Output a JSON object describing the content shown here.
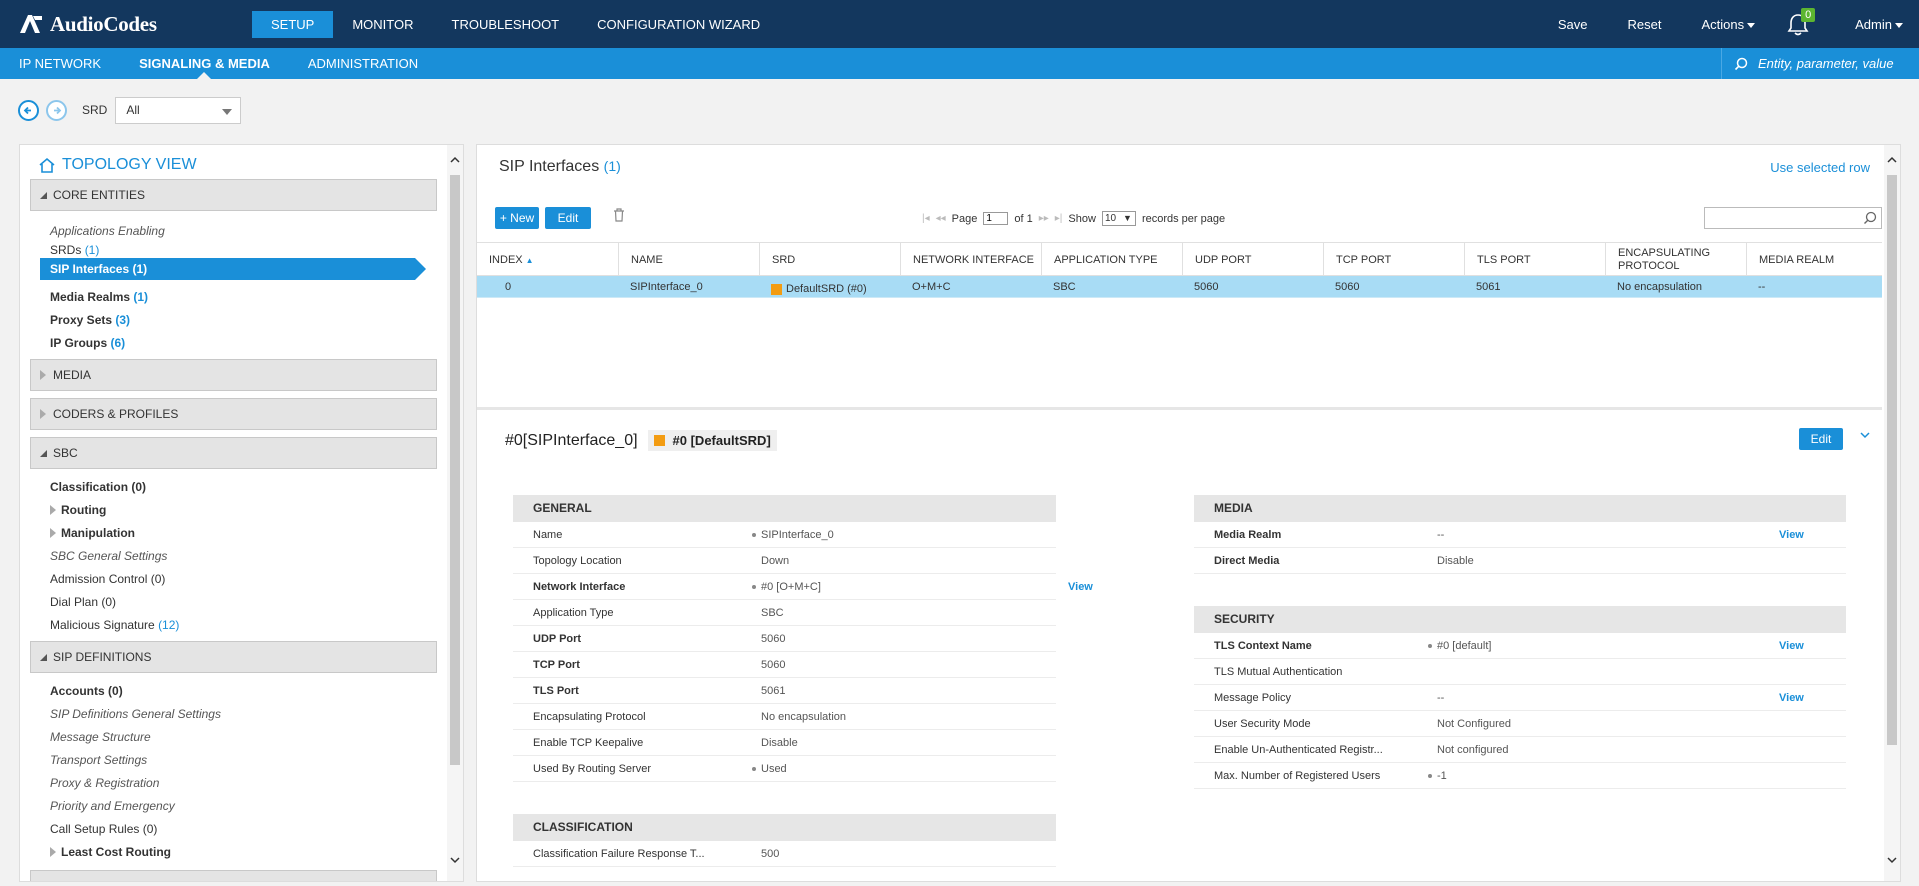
{
  "brand": {
    "name": "AudioCodes"
  },
  "main_nav": [
    {
      "label": "SETUP",
      "active": true
    },
    {
      "label": "MONITOR"
    },
    {
      "label": "TROUBLESHOOT"
    },
    {
      "label": "CONFIGURATION WIZARD"
    }
  ],
  "top_actions": {
    "save": "Save",
    "reset": "Reset",
    "actions": "Actions",
    "notifications": "0",
    "user": "Admin"
  },
  "sub_nav": [
    {
      "label": "IP NETWORK"
    },
    {
      "label": "SIGNALING & MEDIA",
      "active": true
    },
    {
      "label": "ADMINISTRATION"
    }
  ],
  "global_search": {
    "placeholder": "Entity, parameter, value"
  },
  "srd": {
    "label": "SRD",
    "value": "All"
  },
  "topology": {
    "title": "TOPOLOGY VIEW",
    "core_entities": {
      "label": "CORE ENTITIES",
      "items": [
        {
          "label": "Applications Enabling",
          "count": ""
        },
        {
          "label": "SRDs",
          "count": "(1)"
        },
        {
          "label": "SIP Interfaces",
          "count": "(1)"
        },
        {
          "label": "Media Realms",
          "count": "(1)"
        },
        {
          "label": "Proxy Sets",
          "count": "(3)"
        },
        {
          "label": "IP Groups",
          "count": "(6)"
        }
      ]
    },
    "media": {
      "label": "MEDIA"
    },
    "coders": {
      "label": "CODERS & PROFILES"
    },
    "sbc": {
      "label": "SBC",
      "items": [
        {
          "label": "Classification",
          "count": "(0)"
        },
        {
          "label": "Routing"
        },
        {
          "label": "Manipulation"
        },
        {
          "label": "SBC General Settings"
        },
        {
          "label": "Admission Control",
          "count": "(0)"
        },
        {
          "label": "Dial Plan",
          "count": "(0)"
        },
        {
          "label": "Malicious Signature",
          "count": "(12)"
        }
      ]
    },
    "sip_definitions": {
      "label": "SIP DEFINITIONS",
      "items": [
        {
          "label": "Accounts",
          "count": "(0)"
        },
        {
          "label": "SIP Definitions General Settings"
        },
        {
          "label": "Message Structure"
        },
        {
          "label": "Transport Settings"
        },
        {
          "label": "Proxy & Registration"
        },
        {
          "label": "Priority and Emergency"
        },
        {
          "label": "Call Setup Rules",
          "count": "(0)"
        },
        {
          "label": "Least Cost Routing"
        }
      ]
    }
  },
  "table": {
    "title": "SIP Interfaces",
    "count": "(1)",
    "use_selected": "Use selected row",
    "new_btn": "+ New",
    "edit_btn": "Edit",
    "pager": {
      "page_label": "Page",
      "page_value": "1",
      "of_label": "of 1",
      "show_label": "Show",
      "per_page": "10",
      "records_label": "records per page"
    },
    "columns": [
      "INDEX",
      "NAME",
      "SRD",
      "NETWORK INTERFACE",
      "APPLICATION TYPE",
      "UDP PORT",
      "TCP PORT",
      "TLS PORT",
      "ENCAPSULATING PROTOCOL",
      "MEDIA REALM"
    ],
    "rows": [
      {
        "index": "0",
        "name": "SIPInterface_0",
        "srd": "DefaultSRD (#0)",
        "network_interface": "O+M+C",
        "application_type": "SBC",
        "udp_port": "5060",
        "tcp_port": "5060",
        "tls_port": "5061",
        "encapsulating_protocol": "No encapsulation",
        "media_realm": "--"
      }
    ]
  },
  "detail": {
    "title": "#0[SIPInterface_0]",
    "srd_tag": "#0 [DefaultSRD]",
    "edit_btn": "Edit",
    "view_label": "View",
    "general": {
      "heading": "GENERAL",
      "rows": [
        {
          "key": "Name",
          "value": "SIPInterface_0"
        },
        {
          "key": "Topology Location",
          "value": "Down"
        },
        {
          "key": "Network Interface",
          "value": "#0 [O+M+C]"
        },
        {
          "key": "Application Type",
          "value": "SBC"
        },
        {
          "key": "UDP Port",
          "value": "5060"
        },
        {
          "key": "TCP Port",
          "value": "5060"
        },
        {
          "key": "TLS Port",
          "value": "5061"
        },
        {
          "key": "Encapsulating Protocol",
          "value": "No encapsulation"
        },
        {
          "key": "Enable TCP Keepalive",
          "value": "Disable"
        },
        {
          "key": "Used By Routing Server",
          "value": "Used"
        }
      ]
    },
    "classification": {
      "heading": "CLASSIFICATION",
      "rows": [
        {
          "key": "Classification Failure Response T...",
          "value": "500"
        }
      ]
    },
    "media": {
      "heading": "MEDIA",
      "rows": [
        {
          "key": "Media Realm",
          "value": "--"
        },
        {
          "key": "Direct Media",
          "value": "Disable"
        }
      ]
    },
    "security": {
      "heading": "SECURITY",
      "rows": [
        {
          "key": "TLS Context Name",
          "value": "#0 [default]"
        },
        {
          "key": "TLS Mutual Authentication",
          "value": ""
        },
        {
          "key": "Message Policy",
          "value": "--"
        },
        {
          "key": "User Security Mode",
          "value": "Not Configured"
        },
        {
          "key": "Enable Un-Authenticated Registr...",
          "value": "Not configured"
        },
        {
          "key": "Max. Number of Registered Users",
          "value": "-1"
        }
      ]
    }
  }
}
